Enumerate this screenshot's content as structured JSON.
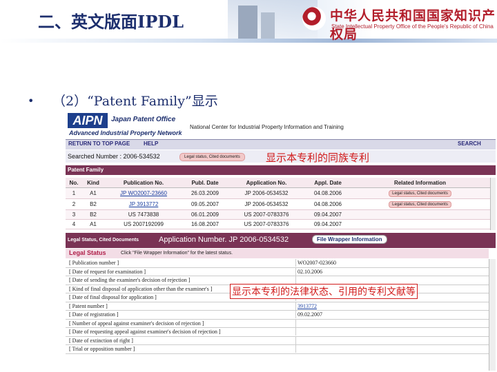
{
  "slide": {
    "title": "二、英文版面IPDL",
    "bullet_mark": "•",
    "bullet_text": "（2）“Patent Family”显示"
  },
  "logo": {
    "cn": "中华人民共和国国家知识产权局",
    "en": "State Intellectual Property Office of the People's Republic of China"
  },
  "aipn": {
    "logo_text": "AIPN",
    "japan_office": "Japan Patent Office",
    "full_name": "Advanced Industrial Property Network",
    "center": "National Center for Industrial Property Information and Training"
  },
  "nav": {
    "return": "RETURN TO TOP PAGE",
    "help": "HELP",
    "search": "SEARCH"
  },
  "searched": {
    "label": "Searched Number : 2006-534532",
    "pill": "Legal status, Cited documents"
  },
  "annotations": {
    "family": "显示本专利的同族专利",
    "legal": "显示本专利的法律状态、引用的专利文献等"
  },
  "patent_family": {
    "title": "Patent Family",
    "columns": [
      "No.",
      "Kind",
      "Publication No.",
      "Publ. Date",
      "Application No.",
      "Appl. Date",
      "Related Information"
    ],
    "rows": [
      {
        "no": "1",
        "kind": "A1",
        "pub": "JP WO2007-23660",
        "pub_date": "26.03.2009",
        "app": "JP 2006-0534532",
        "app_date": "04.08.2006",
        "info": "Legal status, Cited documents"
      },
      {
        "no": "2",
        "kind": "B2",
        "pub": "JP 3913772",
        "pub_date": "09.05.2007",
        "app": "JP 2006-0534532",
        "app_date": "04.08.2006",
        "info": "Legal status, Cited documents"
      },
      {
        "no": "3",
        "kind": "B2",
        "pub": "US 7473838",
        "pub_date": "06.01.2009",
        "app": "US 2007-0783376",
        "app_date": "09.04.2007",
        "info": ""
      },
      {
        "no": "4",
        "kind": "A1",
        "pub": "US 2007192099",
        "pub_date": "16.08.2007",
        "app": "US 2007-0783376",
        "app_date": "09.04.2007",
        "info": ""
      }
    ]
  },
  "legal_status": {
    "bar_title": "Legal Status, Cited Documents",
    "app_number": "Application Number. JP 2006-0534532",
    "fwi_button": "File Wrapper Information",
    "head_title": "Legal Status",
    "head_note": "Click \"File Wrapper Information\" for the latest status.",
    "rows": [
      {
        "label": "[ Publication number ]",
        "value": "WO2007-023660"
      },
      {
        "label": "[ Date of request for examination ]",
        "value": "02.10.2006"
      },
      {
        "label": "[ Date of sending the examiner's decision of rejection ]",
        "value": ""
      },
      {
        "label": "[ Kind of final disposal of application other than the examiner's ]",
        "value": ""
      },
      {
        "label": "[ Date of final disposal for application ]",
        "value": ""
      },
      {
        "label": "[ Patent number ]",
        "value": "3913772"
      },
      {
        "label": "[ Date of registration ]",
        "value": "09.02.2007"
      },
      {
        "label": "[ Number of appeal against examiner's decision of rejection ]",
        "value": ""
      },
      {
        "label": "[ Date of requesting appeal against examiner's decision of rejection ]",
        "value": ""
      },
      {
        "label": "[ Date of extinction of right ]",
        "value": ""
      },
      {
        "label": "[ Trial or opposition number ]",
        "value": ""
      }
    ]
  }
}
